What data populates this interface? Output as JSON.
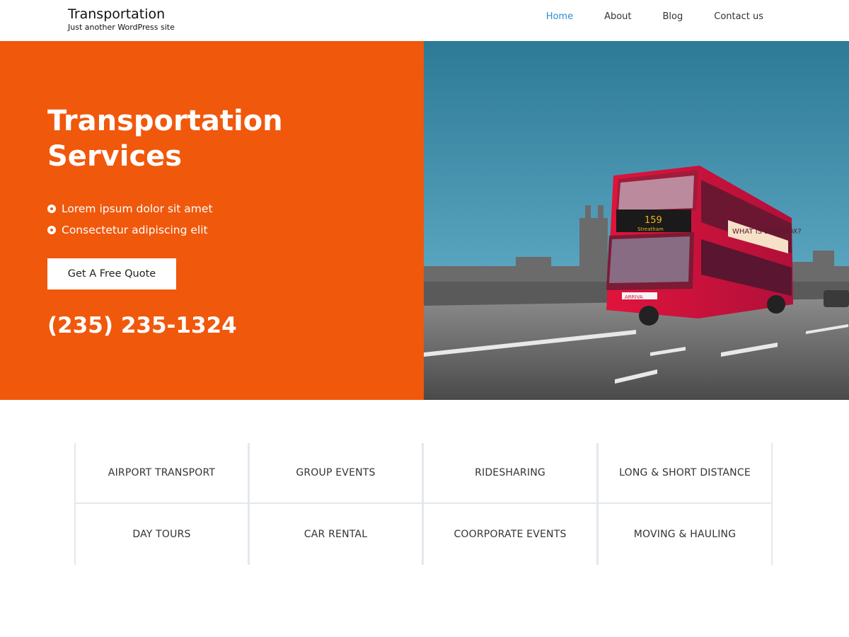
{
  "header": {
    "site_title": "Transportation",
    "tagline": "Just another WordPress site",
    "nav": [
      {
        "label": "Home",
        "active": true
      },
      {
        "label": "About",
        "active": false
      },
      {
        "label": "Blog",
        "active": false
      },
      {
        "label": "Contact us",
        "active": false
      }
    ],
    "active_color": "#2d8fd5"
  },
  "hero": {
    "title": "Transportation Services",
    "bullets": [
      "Lorem ipsum dolor sit amet",
      "Consectetur adipiscing elit"
    ],
    "cta_label": "Get A Free Quote",
    "phone": "(235) 235-1324",
    "background_color": "#f0580c",
    "image": {
      "subject": "red double-decker bus on city bridge",
      "bus_destination_number": "159",
      "bus_destination": "Streatham",
      "bus_banner": "WHAT IS BASEBOX?",
      "bus_operator": "ARRIVA"
    }
  },
  "services": [
    "AIRPORT TRANSPORT",
    "GROUP EVENTS",
    "RIDESHARING",
    "LONG & SHORT DISTANCE",
    "DAY TOURS",
    "CAR RENTAL",
    "COORPORATE EVENTS",
    "MOVING & HAULING"
  ]
}
